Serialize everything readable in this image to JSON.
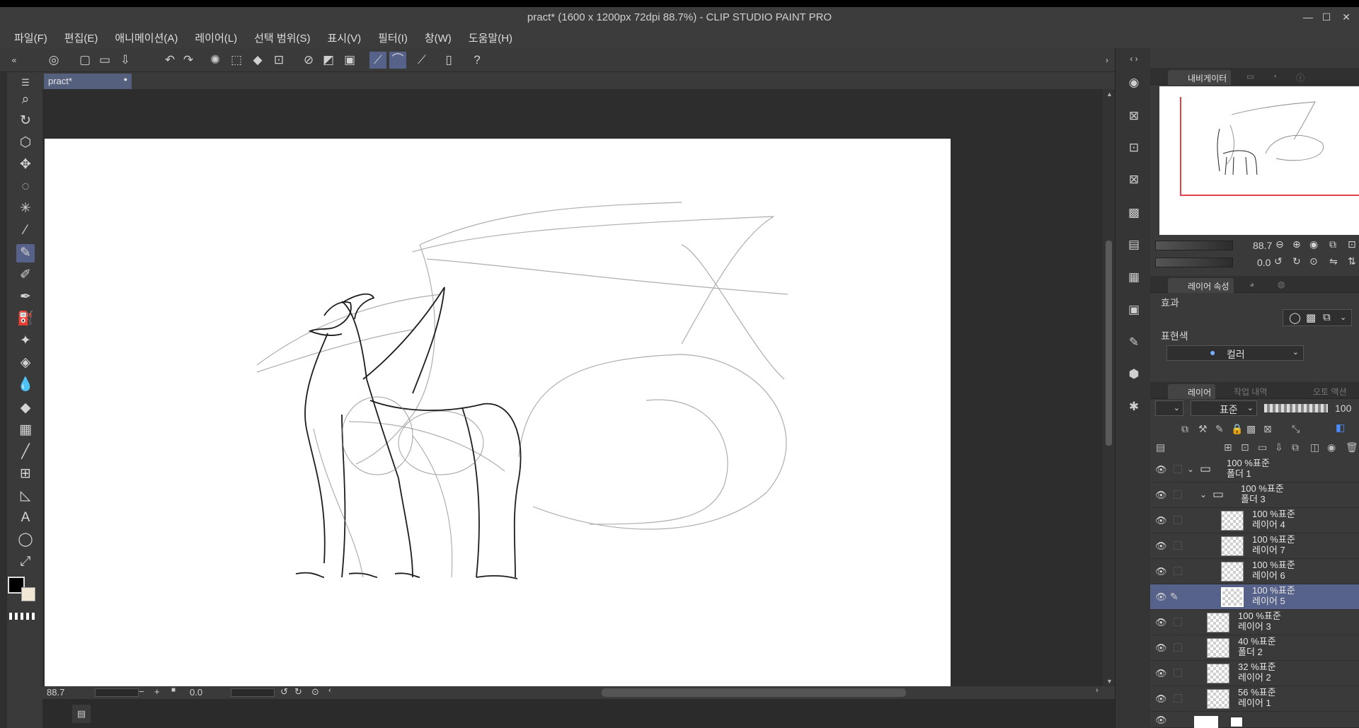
{
  "window": {
    "title": "pract* (1600 x 1200px 72dpi 88.7%)  - CLIP STUDIO PAINT PRO"
  },
  "menu": [
    {
      "label": "파일(F)"
    },
    {
      "label": "편집(E)"
    },
    {
      "label": "애니메이션(A)"
    },
    {
      "label": "레이어(L)"
    },
    {
      "label": "선택 범위(S)"
    },
    {
      "label": "표시(V)"
    },
    {
      "label": "필터(I)"
    },
    {
      "label": "창(W)"
    },
    {
      "label": "도움말(H)"
    }
  ],
  "document": {
    "tab_label": "pract*"
  },
  "status": {
    "zoom": "88.7",
    "rotation": "0.0"
  },
  "navigator": {
    "tab_label": "내비게이터",
    "zoom": "88.7",
    "rotation": "0.0"
  },
  "layer_property": {
    "tab_label": "레이어 속성",
    "effect_label": "효과",
    "expression_color_label": "표현색",
    "expression_color_value": "컬러"
  },
  "layers_panel": {
    "tab_label": "레이어",
    "tab2_label": "작업 내역",
    "tab3_label": "오토 액션",
    "blend_mode": "표준",
    "opacity": "100"
  },
  "layers": [
    {
      "mode": "100 %표준",
      "name": "폴더 1",
      "type": "folder",
      "level": 0
    },
    {
      "mode": "100 %표준",
      "name": "폴더 3",
      "type": "folder",
      "level": 1
    },
    {
      "mode": "100 %표준",
      "name": "레이어 4",
      "type": "layer",
      "level": 2
    },
    {
      "mode": "100 %표준",
      "name": "레이어 7",
      "type": "layer",
      "level": 2
    },
    {
      "mode": "100 %표준",
      "name": "레이어 6",
      "type": "layer",
      "level": 2
    },
    {
      "mode": "100 %표준",
      "name": "레이어 5",
      "type": "layer",
      "level": 2,
      "selected": true
    },
    {
      "mode": "100 %표준",
      "name": "레이어 3",
      "type": "layer",
      "level": 1
    },
    {
      "mode": "40 %표준",
      "name": "폴더 2",
      "type": "layer",
      "level": 1
    },
    {
      "mode": "32 %표준",
      "name": "레이어 2",
      "type": "layer",
      "level": 1
    },
    {
      "mode": "56 %표준",
      "name": "레이어 1",
      "type": "layer",
      "level": 1
    }
  ],
  "colors": {
    "accent": "#566289",
    "navigator_frame": "#e0424a",
    "main_color": "#000000",
    "sub_color": "#f2e6d4"
  }
}
